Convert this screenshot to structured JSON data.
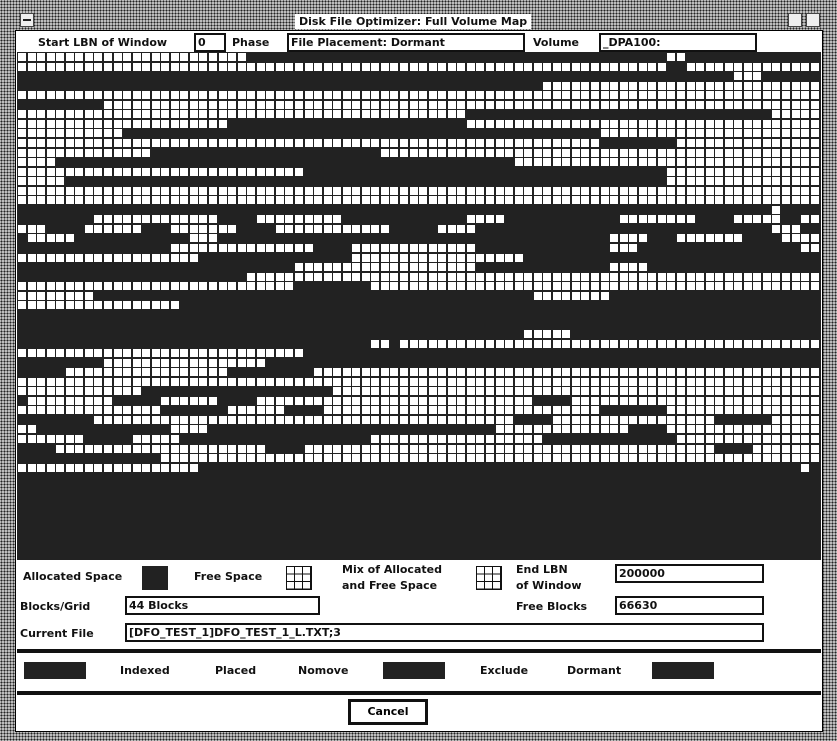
{
  "window": {
    "title": "Disk File Optimizer: Full Volume Map",
    "menu_icon": "window-menu-icon",
    "minimize_icon": "minimize-icon",
    "maximize_icon": "maximize-icon"
  },
  "header": {
    "start_lbn_label": "Start LBN of Window",
    "start_lbn_value": "0",
    "phase_label": "Phase",
    "phase_value": "File Placement: Dormant",
    "volume_label": "Volume",
    "volume_value": "_DPA100:"
  },
  "map": {
    "columns": 84,
    "rows": [
      [
        [
          0,
          24
        ],
        [
          68,
          70
        ]
      ],
      [
        [
          0,
          68
        ],
        [
          70,
          84
        ]
      ],
      [
        [
          75,
          78
        ]
      ],
      [
        [
          55,
          84
        ]
      ],
      [
        [
          0,
          84
        ]
      ],
      [
        [
          9,
          84
        ]
      ],
      [
        [
          0,
          47
        ],
        [
          79,
          84
        ]
      ],
      [
        [
          0,
          22
        ],
        [
          47,
          84
        ]
      ],
      [
        [
          0,
          11
        ],
        [
          61,
          84
        ]
      ],
      [
        [
          0,
          61
        ],
        [
          69,
          84
        ]
      ],
      [
        [
          0,
          14
        ],
        [
          38,
          84
        ]
      ],
      [
        [
          0,
          4
        ],
        [
          52,
          84
        ]
      ],
      [
        [
          0,
          30
        ],
        [
          68,
          84
        ]
      ],
      [
        [
          0,
          5
        ],
        [
          68,
          84
        ]
      ],
      [
        [
          0,
          84
        ]
      ],
      [
        [
          0,
          3
        ],
        [
          3,
          84
        ]
      ],
      [
        [
          79,
          80
        ]
      ],
      [
        [
          8,
          21
        ],
        [
          25,
          34
        ],
        [
          47,
          51
        ],
        [
          63,
          71
        ],
        [
          75,
          80
        ],
        [
          82,
          84
        ]
      ],
      [
        [
          0,
          3
        ],
        [
          7,
          13
        ],
        [
          16,
          23
        ],
        [
          27,
          39
        ],
        [
          44,
          48
        ],
        [
          79,
          82
        ]
      ],
      [
        [
          1,
          6
        ],
        [
          18,
          21
        ],
        [
          62,
          66
        ],
        [
          69,
          76
        ],
        [
          80,
          84
        ]
      ],
      [
        [
          16,
          31
        ],
        [
          35,
          48
        ],
        [
          62,
          65
        ],
        [
          82,
          84
        ]
      ],
      [
        [
          0,
          19
        ],
        [
          35,
          53
        ]
      ],
      [
        [
          29,
          48
        ],
        [
          62,
          66
        ]
      ],
      [
        [
          24,
          84
        ]
      ],
      [
        [
          0,
          29
        ],
        [
          37,
          84
        ]
      ],
      [
        [
          0,
          8
        ],
        [
          54,
          62
        ]
      ],
      [
        [
          0,
          17
        ]
      ],
      [],
      [],
      [
        [
          53,
          58
        ]
      ],
      [
        [
          37,
          39
        ],
        [
          40,
          84
        ]
      ],
      [
        [
          0,
          30
        ]
      ],
      [
        [
          9,
          26
        ]
      ],
      [
        [
          5,
          22
        ],
        [
          31,
          84
        ]
      ],
      [
        [
          0,
          84
        ]
      ],
      [
        [
          0,
          13
        ],
        [
          33,
          84
        ]
      ],
      [
        [
          1,
          10
        ],
        [
          15,
          21
        ],
        [
          25,
          54
        ],
        [
          58,
          84
        ]
      ],
      [
        [
          0,
          15
        ],
        [
          22,
          28
        ],
        [
          32,
          61
        ],
        [
          68,
          84
        ]
      ],
      [
        [
          8,
          52
        ],
        [
          56,
          73
        ],
        [
          79,
          84
        ]
      ],
      [
        [
          0,
          2
        ],
        [
          16,
          20
        ],
        [
          50,
          64
        ],
        [
          68,
          84
        ]
      ],
      [
        [
          0,
          7
        ],
        [
          12,
          17
        ],
        [
          37,
          55
        ],
        [
          69,
          84
        ]
      ],
      [
        [
          4,
          26
        ],
        [
          30,
          73
        ],
        [
          77,
          84
        ]
      ],
      [
        [
          15,
          84
        ]
      ],
      [
        [
          0,
          19
        ],
        [
          82,
          83
        ]
      ]
    ]
  },
  "legend": {
    "allocated_label": "Allocated Space",
    "free_label": "Free Space",
    "mix_label_line1": "Mix of Allocated",
    "mix_label_line2": "and Free Space",
    "end_lbn_label_line1": "End LBN",
    "end_lbn_label_line2": "of Window",
    "end_lbn_value": "200000"
  },
  "info": {
    "blocks_grid_label": "Blocks/Grid",
    "blocks_grid_value": "44 Blocks",
    "free_blocks_label": "Free Blocks",
    "free_blocks_value": "66630",
    "current_file_label": "Current File",
    "current_file_value": "[DFO_TEST_1]DFO_TEST_1_L.TXT;3"
  },
  "file_types": {
    "indexed": "Indexed",
    "placed": "Placed",
    "nomove": "Nomove",
    "exclude": "Exclude",
    "dormant": "Dormant"
  },
  "buttons": {
    "cancel": "Cancel"
  },
  "colors": {
    "allocated": "#222222",
    "free": "#ffffff"
  }
}
